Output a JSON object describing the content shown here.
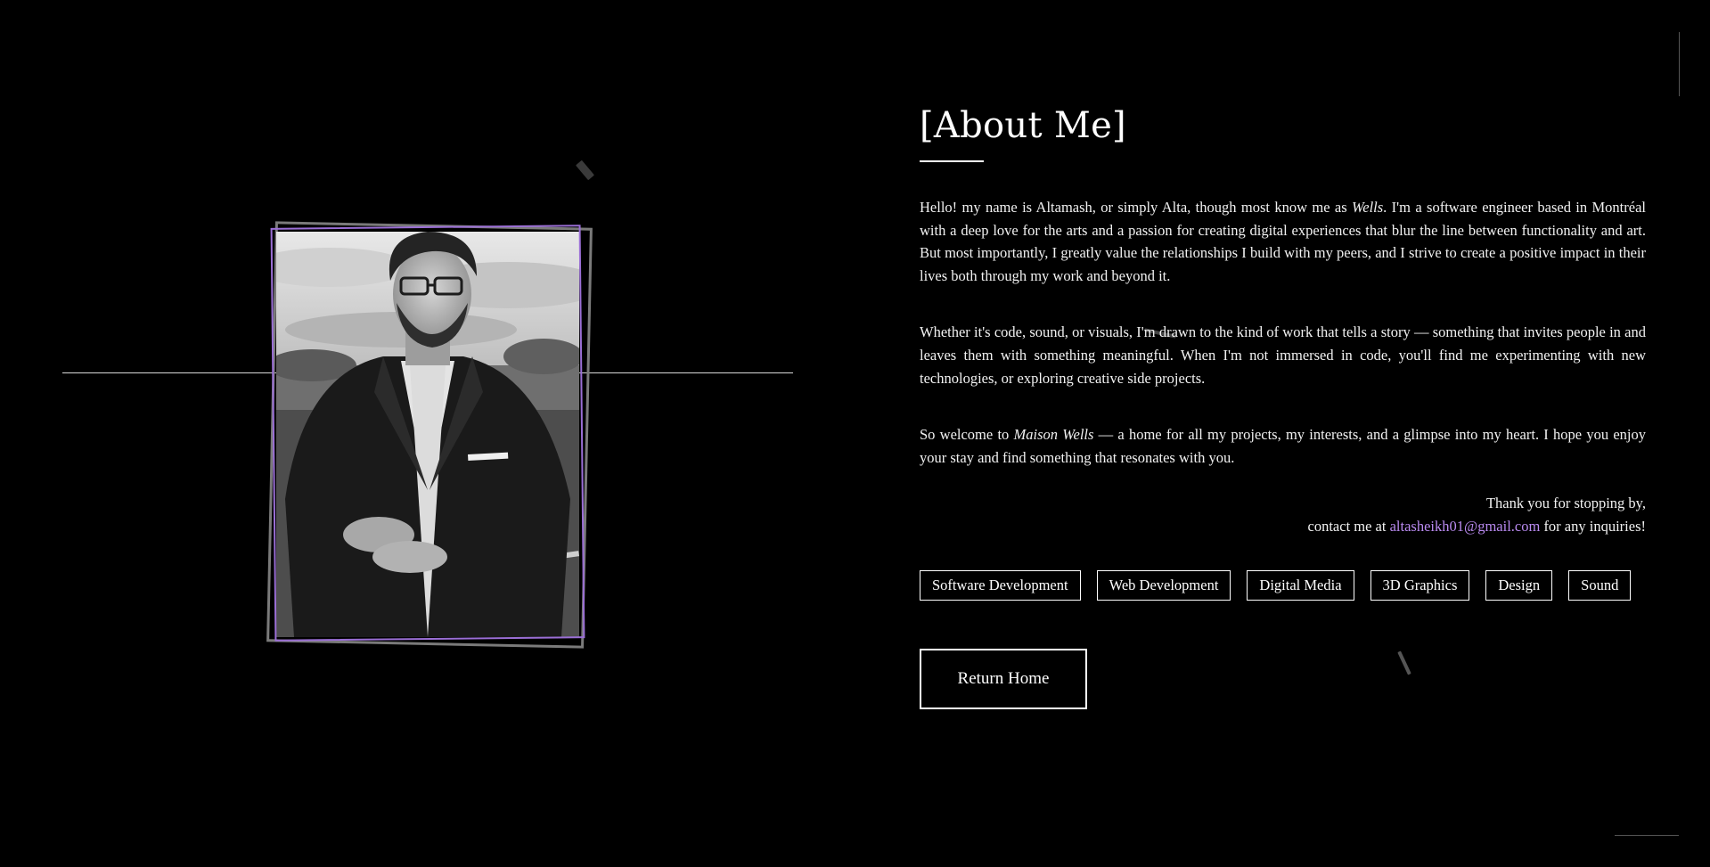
{
  "about": {
    "title": "[About Me]",
    "paragraph1": {
      "before": "Hello! my name is Altamash, or simply Alta, though most know me as ",
      "emphasis": "Wells",
      "after": ". I'm a software engineer based in Montréal with a deep love for the arts and a passion for creating digital experiences that blur the line between functionality and art. But most importantly, I greatly value the relationships I build with my peers, and I strive to create a positive impact in their lives both through my work and beyond it."
    },
    "paragraph2": "Whether it's code, sound, or visuals, I'm drawn to the kind of work that tells a story — something that invites people in and leaves them with something meaningful. When I'm not immersed in code, you'll find me experimenting with new technologies, or exploring creative side projects.",
    "paragraph3": {
      "before": "So welcome to ",
      "emphasis": "Maison Wells",
      "after": " — a home for all my projects, my interests, and a glimpse into my heart. I hope you enjoy your stay and find something that resonates with you."
    },
    "signoff": {
      "thanks": "Thank you for stopping by,",
      "contact_before": "contact me at ",
      "email": "altasheikh01@gmail.com",
      "contact_after": " for any inquiries!"
    },
    "tags": [
      "Software Development",
      "Web Development",
      "Digital Media",
      "3D Graphics",
      "Design",
      "Sound"
    ],
    "return_button": "Return Home"
  },
  "colors": {
    "background": "#000000",
    "accent": "#b98af0",
    "frame_purple": "#9b6fd6"
  }
}
